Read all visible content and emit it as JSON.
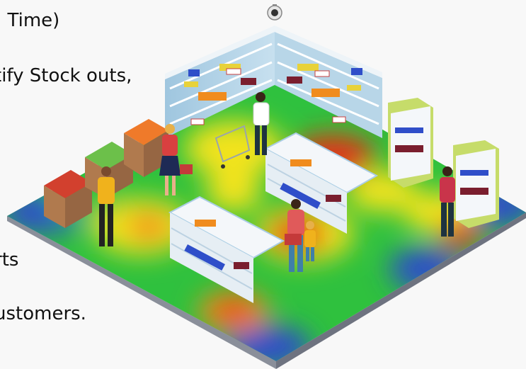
{
  "text_lines": [
    ", Time)",
    "tify Stock outs,",
    "rts",
    "ustomers."
  ],
  "colors": {
    "floor_edge": "#2c3fa3",
    "heat_green": "#2fc13e",
    "heat_yellow": "#f2e31c",
    "heat_orange": "#f08c1e",
    "heat_red": "#e53119",
    "heat_blue": "#2f4ec9",
    "shelf_blue": "#a9cde4",
    "shelf_white": "#f4f7fa",
    "cabinet_green": "#c6dc6a",
    "crate_brown": "#b07a4e"
  },
  "icons": [
    "security-camera-icon"
  ]
}
